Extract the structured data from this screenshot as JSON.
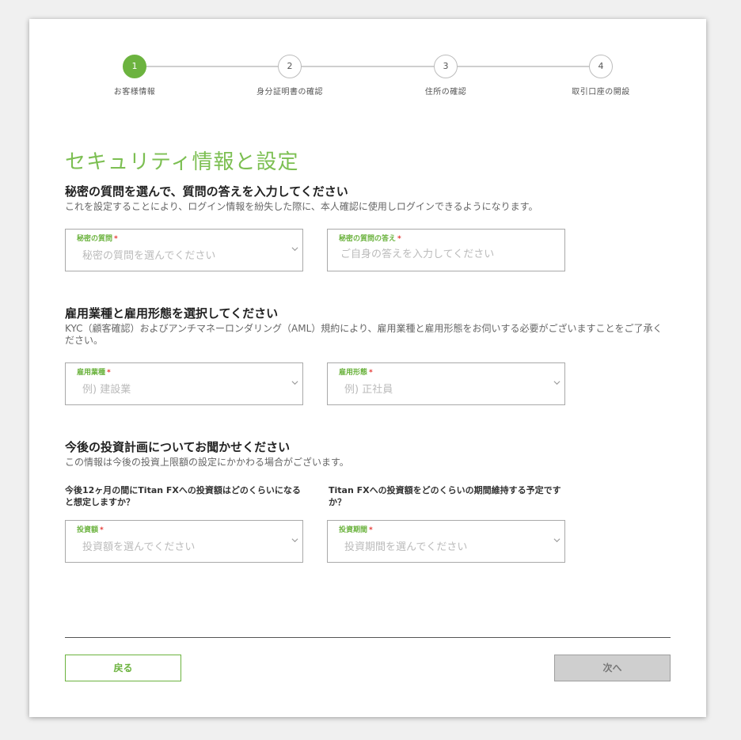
{
  "stepper": {
    "steps": [
      {
        "number": "1",
        "label": "お客様情報"
      },
      {
        "number": "2",
        "label": "身分証明書の確認"
      },
      {
        "number": "3",
        "label": "住所の確認"
      },
      {
        "number": "4",
        "label": "取引口座の開設"
      }
    ],
    "active_step": 1
  },
  "page_title": "セキュリティ情報と設定",
  "security": {
    "title": "秘密の質問を選んで、質問の答えを入力してください",
    "description": "これを設定することにより、ログイン情報を紛失した際に、本人確認に使用しログインできるようになります。",
    "question_field": {
      "label": "秘密の質問",
      "placeholder": "秘密の質問を選んでください"
    },
    "answer_field": {
      "label": "秘密の質問の答え",
      "placeholder": "ご自身の答えを入力してください"
    }
  },
  "employment": {
    "title": "雇用業種と雇用形態を選択してください",
    "description": "KYC（顧客確認）およびアンチマネーロンダリング（AML）規約により、雇用業種と雇用形態をお伺いする必要がございますことをご了承ください。",
    "industry_field": {
      "label": "雇用業種",
      "placeholder": "例) 建設業"
    },
    "type_field": {
      "label": "雇用形態",
      "placeholder": "例) 正社員"
    }
  },
  "investment": {
    "title": "今後の投資計画についてお聞かせください",
    "description": "この情報は今後の投資上限額の設定にかかわる場合がございます。",
    "amount_question": "今後12ヶ月の間にTitan FXへの投資額はどのくらいになると想定しますか？",
    "period_question": "Titan FXへの投資額をどのくらいの期間維持する予定ですか？",
    "amount_field": {
      "label": "投資額",
      "placeholder": "投資額を選んでください"
    },
    "period_field": {
      "label": "投資期間",
      "placeholder": "投資期間を選んでください"
    }
  },
  "required_mark": "*",
  "buttons": {
    "back": "戻る",
    "next": "次へ"
  },
  "colors": {
    "accent": "#6cb33f",
    "title": "#7cbf52",
    "required": "#e53935",
    "disabled_button": "#cfcfcf"
  }
}
